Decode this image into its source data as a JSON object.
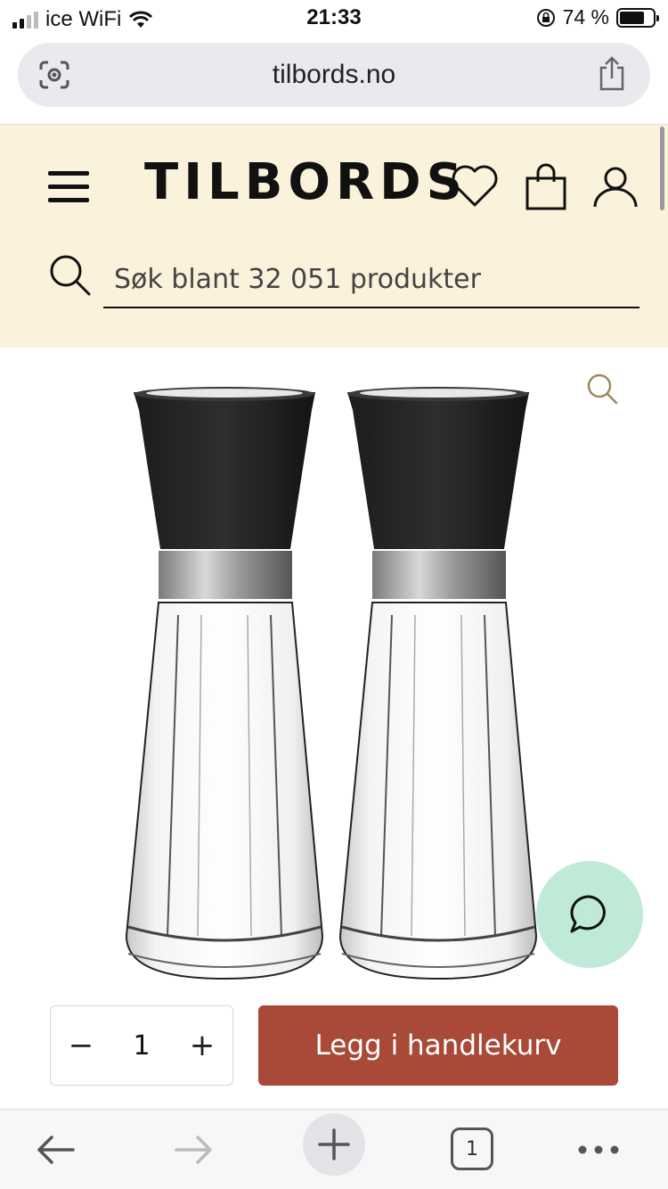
{
  "status_bar": {
    "carrier": "ice WiFi",
    "time": "21:33",
    "battery": "74 %",
    "battery_level": 0.74
  },
  "browser": {
    "url": "tilbords.no",
    "tab_count": "1"
  },
  "header": {
    "logo": "TILBORDS",
    "search_placeholder": "Søk blant 32 051 produkter"
  },
  "purchase": {
    "quantity": "1",
    "minus": "−",
    "plus": "+",
    "add_to_cart": "Legg i handlekurv"
  },
  "icons": {
    "menu": "menu-icon",
    "favorites": "heart-icon",
    "cart": "shopping-bag-icon",
    "account": "user-icon",
    "search": "search-icon",
    "zoom": "zoom-icon",
    "chat": "chat-icon",
    "share": "share-icon",
    "lens": "lens-icon",
    "back": "back-arrow-icon",
    "forward": "forward-arrow-icon",
    "new_tab": "plus-icon",
    "more": "more-icon"
  },
  "colors": {
    "header_bg": "#fbf2dc",
    "cta": "#a84a37",
    "chat_bg": "#bfead8"
  }
}
